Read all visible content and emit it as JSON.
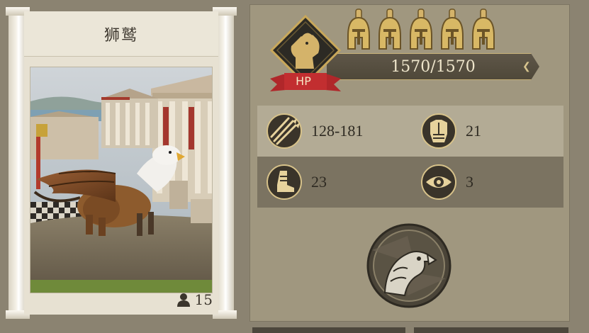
{
  "unit": {
    "name": "狮鹫",
    "population": "15",
    "population_icon": "person-icon"
  },
  "hp": {
    "label": "HP",
    "value": "1570/1570",
    "fraction": 1.0
  },
  "rank": {
    "helmets": 5,
    "helmet_icon": "helmet-icon"
  },
  "stats": {
    "attack": {
      "icon": "arrows-icon",
      "value": "128-181"
    },
    "armor": {
      "icon": "armor-icon",
      "value": "21"
    },
    "speed": {
      "icon": "boot-icon",
      "value": "23"
    },
    "vision": {
      "icon": "eye-icon",
      "value": "3"
    }
  },
  "ability": {
    "icon": "griffin-head-icon"
  },
  "colors": {
    "background": "#8b8371",
    "panel": "#a0977f",
    "gold": "#d4b36a",
    "hp_ribbon": "#b0272a"
  }
}
